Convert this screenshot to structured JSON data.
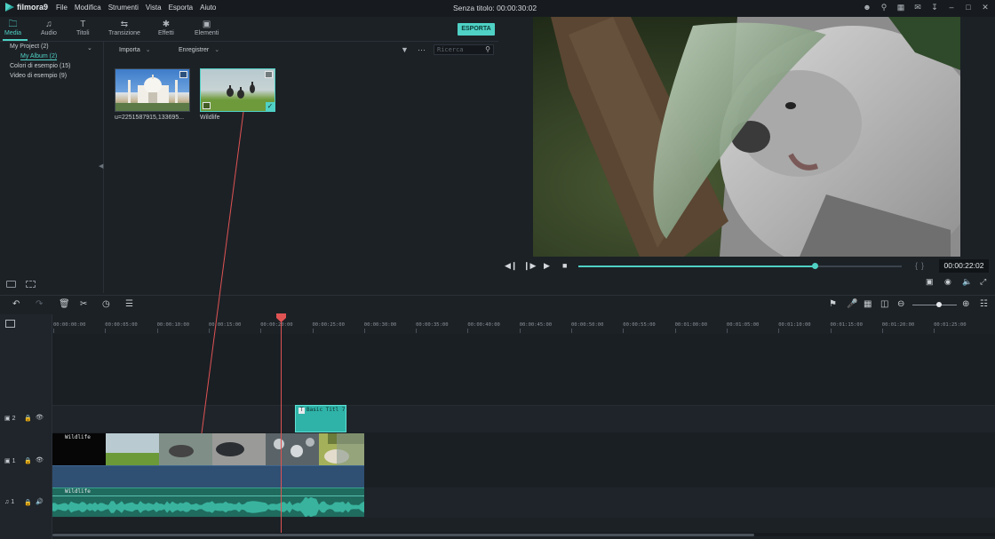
{
  "app": {
    "name": "filmora9",
    "doc_title": "Senza titolo:",
    "doc_time": "00:00:30:02"
  },
  "menu": [
    "File",
    "Modifica",
    "Strumenti",
    "Vista",
    "Esporta",
    "Aiuto"
  ],
  "tabs": [
    {
      "label": "Media",
      "icon": "folder-icon"
    },
    {
      "label": "Audio",
      "icon": "music-note-icon"
    },
    {
      "label": "Titoli",
      "icon": "text-icon"
    },
    {
      "label": "Transizione",
      "icon": "transition-icon"
    },
    {
      "label": "Effetti",
      "icon": "effects-icon"
    },
    {
      "label": "Elementi",
      "icon": "image-icon"
    }
  ],
  "export_label": "ESPORTA",
  "library": {
    "project": "My Project (2)",
    "album": "My Album (2)",
    "samples_colors": "Colori di esempio (15)",
    "samples_video": "Video di esempio (9)"
  },
  "media_toolbar": {
    "import_label": "Importa",
    "record_label": "Enregistrer",
    "search_placeholder": "Ricerca"
  },
  "media_items": [
    {
      "label": "u=2251587915,133695..."
    },
    {
      "label": "Wildlife"
    }
  ],
  "preview": {
    "timecode": "00:00:22:02",
    "progress": 0.73
  },
  "timeline": {
    "ruler_labels": [
      "00:00:00:00",
      "00:00:05:00",
      "00:00:10:00",
      "00:00:15:00",
      "00:00:20:00",
      "00:00:25:00",
      "00:00:30:00",
      "00:00:35:00",
      "00:00:40:00",
      "00:00:45:00",
      "00:00:50:00",
      "00:00:55:00",
      "00:01:00:00",
      "00:01:05:00",
      "00:01:10:00",
      "00:01:15:00",
      "00:01:20:00",
      "00:01:25:00"
    ],
    "track2_label": "2",
    "track1_label": "1",
    "audio_label": "1",
    "video_clip_title": "Wildlife",
    "audio_clip_title": "Wildlife",
    "title_clip_label": "Basic Titl 7"
  },
  "colors": {
    "accent": "#4fd1c5",
    "playhead": "#e05353",
    "bg": "#1c2126"
  }
}
